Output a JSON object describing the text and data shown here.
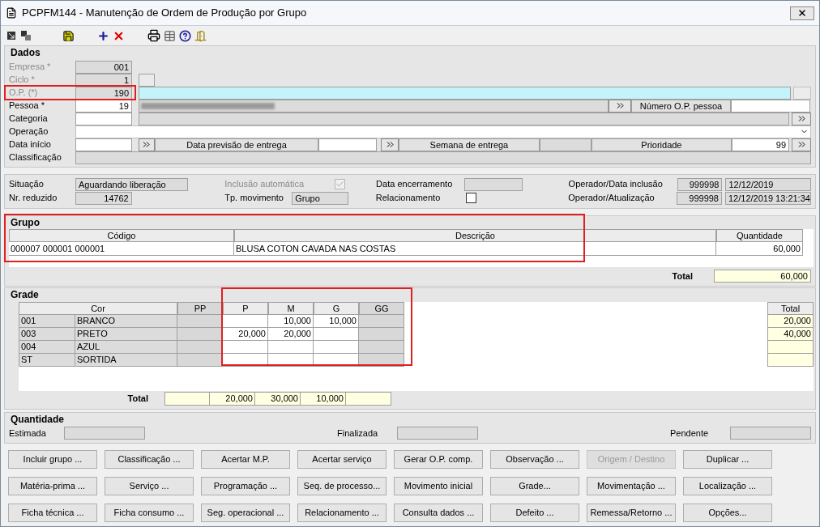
{
  "window": {
    "title": "PCPFM144 - Manutenção de Ordem de Produção por Grupo"
  },
  "dados": {
    "title": "Dados",
    "empresa": {
      "label": "Empresa *",
      "value": "001",
      "disabled": true
    },
    "ciclo": {
      "label": "Ciclo *",
      "value": "1",
      "disabled": true
    },
    "op": {
      "label": "O.P. (*)",
      "value": "190",
      "disabled": true
    },
    "pessoa": {
      "label": "Pessoa *",
      "value": "19",
      "disabled": false
    },
    "numero_op_pessoa": {
      "label": "Número O.P. pessoa"
    },
    "categoria": {
      "label": "Categoria"
    },
    "operacao": {
      "label": "Operação"
    },
    "data_inicio": {
      "label": "Data início"
    },
    "data_previsao": {
      "label": "Data previsão de entrega"
    },
    "semana": {
      "label": "Semana de entrega"
    },
    "prioridade": {
      "label": "Prioridade",
      "value": "99"
    },
    "classificacao": {
      "label": "Classificação"
    }
  },
  "status": {
    "situacao": {
      "label": "Situação",
      "value": "Aguardando liberação"
    },
    "nr_reduzido": {
      "label": "Nr. reduzido",
      "value": "14762"
    },
    "inclusao_automatica": {
      "label": "Inclusão automática",
      "checked": true,
      "disabled": true
    },
    "tp_movimento": {
      "label": "Tp. movimento",
      "value": "Grupo"
    },
    "data_encerramento": {
      "label": "Data encerramento"
    },
    "relacionamento": {
      "label": "Relacionamento",
      "checked": false,
      "disabled": false
    },
    "operador_inclusao": {
      "label": "Operador/Data inclusão",
      "operator": "999998",
      "date": "12/12/2019"
    },
    "operador_atualizacao": {
      "label": "Operador/Atualização",
      "operator": "999998",
      "date": "12/12/2019 13:21:34"
    }
  },
  "grupo": {
    "title": "Grupo",
    "columns": [
      "Código",
      "Descrição",
      "Quantidade"
    ],
    "rows": [
      {
        "cells": [
          "000007 000001 000001",
          "BLUSA COTON CAVADA NAS COSTAS",
          "60,000"
        ]
      }
    ],
    "total_label": "Total",
    "total": "60,000"
  },
  "grade": {
    "title": "Grade",
    "color_column": "Cor",
    "total_column": "Total",
    "sizes": [
      {
        "label": "PP",
        "disabled": true
      },
      {
        "label": "P",
        "disabled": false
      },
      {
        "label": "M",
        "disabled": false
      },
      {
        "label": "G",
        "disabled": false
      },
      {
        "label": "GG",
        "disabled": true
      }
    ],
    "rows": [
      {
        "code": "001",
        "name": "BRANCO",
        "values": [
          {
            "kind": "blank"
          },
          {
            "kind": "blank"
          },
          {
            "kind": "number",
            "value": "10,000"
          },
          {
            "kind": "number",
            "value": "10,000"
          },
          {
            "kind": "blank"
          }
        ],
        "total": {
          "kind": "number",
          "value": "20,000"
        }
      },
      {
        "code": "003",
        "name": "PRETO",
        "values": [
          {
            "kind": "blank"
          },
          {
            "kind": "number",
            "value": "20,000"
          },
          {
            "kind": "number",
            "value": "20,000"
          },
          {
            "kind": "blank"
          },
          {
            "kind": "blank"
          }
        ],
        "total": {
          "kind": "number",
          "value": "40,000"
        }
      },
      {
        "code": "004",
        "name": "AZUL",
        "values": [
          {
            "kind": "blank"
          },
          {
            "kind": "blank"
          },
          {
            "kind": "blank"
          },
          {
            "kind": "blank"
          },
          {
            "kind": "blank"
          }
        ],
        "total": {
          "kind": "blank"
        }
      },
      {
        "code": "ST",
        "name": "SORTIDA",
        "values": [
          {
            "kind": "blank"
          },
          {
            "kind": "blank"
          },
          {
            "kind": "blank"
          },
          {
            "kind": "blank"
          },
          {
            "kind": "blank"
          }
        ],
        "total": {
          "kind": "blank"
        }
      }
    ],
    "totals_label": "Total",
    "totals": [
      {
        "kind": "blank"
      },
      {
        "kind": "number",
        "value": "20,000"
      },
      {
        "kind": "number",
        "value": "30,000"
      },
      {
        "kind": "number",
        "value": "10,000"
      },
      {
        "kind": "blank"
      }
    ]
  },
  "quantidade": {
    "title": "Quantidade",
    "fields": [
      "Estimada",
      "Finalizada",
      "Pendente"
    ]
  },
  "buttons": [
    [
      {
        "label": "Incluir grupo ...",
        "disabled": false
      },
      {
        "label": "Classificação ...",
        "disabled": false
      },
      {
        "label": "Acertar M.P.",
        "disabled": false
      },
      {
        "label": "Acertar serviço",
        "disabled": false
      },
      {
        "label": "Gerar O.P. comp.",
        "disabled": false
      },
      {
        "label": "Observação ...",
        "disabled": false
      },
      {
        "label": "Origem / Destino",
        "disabled": true
      },
      {
        "label": "Duplicar ...",
        "disabled": false
      }
    ],
    [
      {
        "label": "Matéria-prima ...",
        "disabled": false
      },
      {
        "label": "Serviço ...",
        "disabled": false
      },
      {
        "label": "Programação ...",
        "disabled": false
      },
      {
        "label": "Seq. de processo...",
        "disabled": false
      },
      {
        "label": "Movimento inicial",
        "disabled": false
      },
      {
        "label": "Grade...",
        "disabled": false
      },
      {
        "label": "Movimentação ...",
        "disabled": false
      },
      {
        "label": "Localização ...",
        "disabled": false
      }
    ],
    [
      {
        "label": "Ficha técnica ...",
        "disabled": false
      },
      {
        "label": "Ficha consumo ...",
        "disabled": false
      },
      {
        "label": "Seg. operacional ...",
        "disabled": false
      },
      {
        "label": "Relacionamento ...",
        "disabled": false
      },
      {
        "label": "Consulta dados ...",
        "disabled": false
      },
      {
        "label": "Defeito ...",
        "disabled": false
      },
      {
        "label": "Remessa/Retorno ...",
        "disabled": false
      },
      {
        "label": "Opções...",
        "disabled": false
      }
    ]
  ]
}
